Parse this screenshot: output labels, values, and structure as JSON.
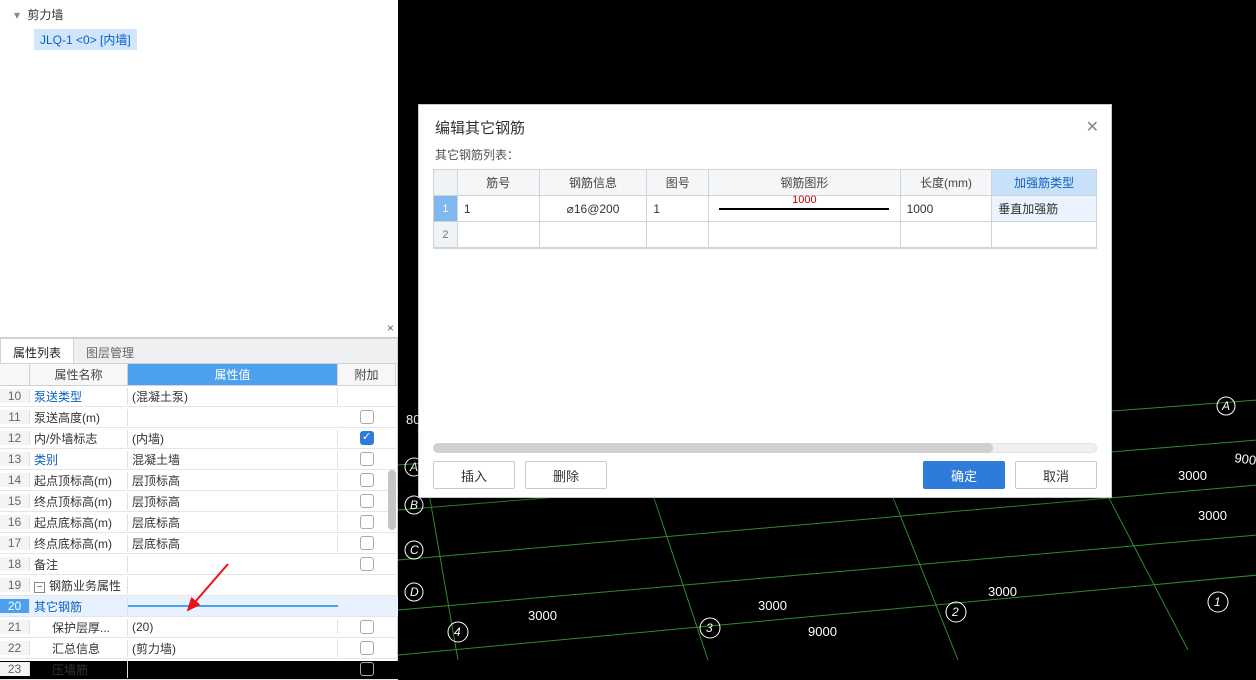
{
  "tree": {
    "root": "剪力墙",
    "child": "JLQ-1 <0> [内墙]"
  },
  "tabs": {
    "t1": "属性列表",
    "t2": "图层管理"
  },
  "propHeader": {
    "name": "属性名称",
    "value": "属性值",
    "extra": "附加"
  },
  "props": [
    {
      "n": "10",
      "name": "泵送类型",
      "val": "(混凝土泵)",
      "link": true,
      "chk": null
    },
    {
      "n": "11",
      "name": "泵送高度(m)",
      "val": "",
      "chk": false
    },
    {
      "n": "12",
      "name": "内/外墙标志",
      "val": "(内墙)",
      "chk": true
    },
    {
      "n": "13",
      "name": "类别",
      "val": "混凝土墙",
      "link": true,
      "chk": false
    },
    {
      "n": "14",
      "name": "起点顶标高(m)",
      "val": "层顶标高",
      "chk": false
    },
    {
      "n": "15",
      "name": "终点顶标高(m)",
      "val": "层顶标高",
      "chk": false
    },
    {
      "n": "16",
      "name": "起点底标高(m)",
      "val": "层底标高",
      "chk": false
    },
    {
      "n": "17",
      "name": "终点底标高(m)",
      "val": "层底标高",
      "chk": false
    },
    {
      "n": "18",
      "name": "备注",
      "val": "",
      "chk": false
    },
    {
      "n": "19",
      "name": "钢筋业务属性",
      "val": "",
      "group": true
    },
    {
      "n": "20",
      "name": "其它钢筋",
      "val": "",
      "link": true,
      "sel": true,
      "dots": true
    },
    {
      "n": "21",
      "name": "保护层厚...",
      "val": "(20)",
      "chk": false,
      "indent": true
    },
    {
      "n": "22",
      "name": "汇总信息",
      "val": "(剪力墙)",
      "chk": false,
      "indent": true
    },
    {
      "n": "23",
      "name": "压墙筋",
      "val": "",
      "chk": false,
      "indent": true
    }
  ],
  "dialog": {
    "title": "编辑其它钢筋",
    "subtitle": "其它钢筋列表：",
    "headers": {
      "jh": "筋号",
      "info": "钢筋信息",
      "th": "图号",
      "shape": "钢筋图形",
      "len": "长度(mm)",
      "type": "加强筋类型"
    },
    "rows": [
      {
        "n": "1",
        "jh": "1",
        "info": "⌀16@200",
        "th": "1",
        "shapeLabel": "1000",
        "len": "1000",
        "type": "垂直加强筋"
      },
      {
        "n": "2",
        "jh": "",
        "info": "",
        "th": "",
        "shapeLabel": "",
        "len": "",
        "type": ""
      }
    ],
    "btns": {
      "insert": "插入",
      "delete": "删除",
      "ok": "确定",
      "cancel": "取消"
    }
  },
  "cad": {
    "axisLabels": [
      "A",
      "B",
      "C",
      "D"
    ],
    "numLabels": [
      "1",
      "2",
      "3",
      "4"
    ],
    "dims": {
      "d3000": "3000",
      "d9000": "9000"
    },
    "b80": "80"
  }
}
